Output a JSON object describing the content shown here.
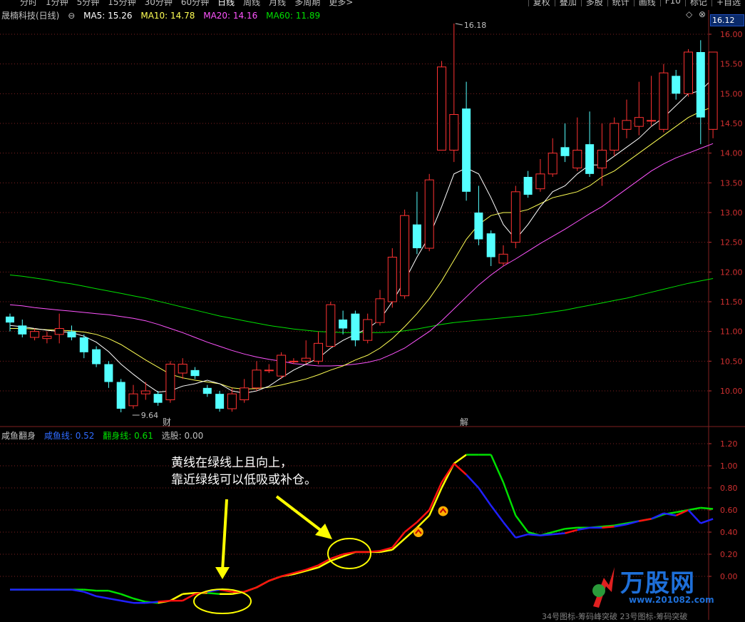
{
  "toolbar": {
    "periods": [
      "分时",
      "1分钟",
      "5分钟",
      "15分钟",
      "30分钟",
      "60分钟",
      "日线",
      "周线",
      "月线",
      "多周期",
      "更多>"
    ],
    "active_period": "日线",
    "tools": [
      "复权",
      "叠加",
      "多股",
      "统计",
      "画线",
      "F10",
      "标记",
      "+自选"
    ]
  },
  "main_legend": {
    "stock": "晟楠科技(日线)",
    "ma5": "MA5: 15.26",
    "ma10": "MA10: 14.78",
    "ma20": "MA20: 14.16",
    "ma60": "MA60: 11.89"
  },
  "colors": {
    "up": "#ff3232",
    "down": "#54ffff",
    "ma5": "#ffffff",
    "ma10": "#ffff54",
    "ma20": "#ff54ff",
    "ma60": "#00e000",
    "indicator_yellow": "#ffff00",
    "indicator_red": "#ff1010",
    "indicator_green": "#00e000",
    "indicator_blue": "#2020ff"
  },
  "current_price_tag": "16.12",
  "indicator_legend": {
    "name": "咸鱼翻身",
    "line1": "咸鱼线: 0.52",
    "line2": "翻身线: 0.61",
    "line3": "选股: 0.00"
  },
  "annotations": {
    "high": "16.18",
    "low": "9.64",
    "marker_cai": "财",
    "marker_jie": "解",
    "note_line1": "黄线在绿线上且向上，",
    "note_line2": "靠近绿线可以低吸或补仓。"
  },
  "watermark": {
    "brand": "万股网",
    "url": "www.201082.com"
  },
  "footer_text": "34号图标-筹码峰突破 23号图标-筹码突破",
  "chart_data": [
    {
      "type": "candlestick",
      "title": "晟楠科技(日线)",
      "ylim": [
        9.6,
        16.25
      ],
      "yticks": [
        10.0,
        10.5,
        11.0,
        11.5,
        12.0,
        12.5,
        13.0,
        13.5,
        14.0,
        14.5,
        15.0,
        15.5,
        16.0
      ],
      "candles": [
        {
          "o": 11.25,
          "c": 11.15,
          "h": 11.3,
          "l": 11.0
        },
        {
          "o": 11.1,
          "c": 10.95,
          "h": 11.2,
          "l": 10.9
        },
        {
          "o": 10.9,
          "c": 11.0,
          "h": 11.05,
          "l": 10.85
        },
        {
          "o": 10.88,
          "c": 10.92,
          "h": 11.0,
          "l": 10.8
        },
        {
          "o": 10.95,
          "c": 11.05,
          "h": 11.3,
          "l": 10.8
        },
        {
          "o": 11.0,
          "c": 10.9,
          "h": 11.1,
          "l": 10.85
        },
        {
          "o": 10.9,
          "c": 10.65,
          "h": 10.95,
          "l": 10.55
        },
        {
          "o": 10.7,
          "c": 10.45,
          "h": 10.75,
          "l": 10.4
        },
        {
          "o": 10.45,
          "c": 10.15,
          "h": 10.5,
          "l": 10.05
        },
        {
          "o": 10.15,
          "c": 9.7,
          "h": 10.2,
          "l": 9.64
        },
        {
          "o": 9.75,
          "c": 9.95,
          "h": 10.1,
          "l": 9.7
        },
        {
          "o": 9.95,
          "c": 10.0,
          "h": 10.15,
          "l": 9.85
        },
        {
          "o": 9.95,
          "c": 9.8,
          "h": 10.0,
          "l": 9.75
        },
        {
          "o": 9.85,
          "c": 10.45,
          "h": 10.5,
          "l": 9.8
        },
        {
          "o": 10.3,
          "c": 10.45,
          "h": 10.55,
          "l": 10.2
        },
        {
          "o": 10.35,
          "c": 10.25,
          "h": 10.4,
          "l": 10.2
        },
        {
          "o": 10.05,
          "c": 9.95,
          "h": 10.1,
          "l": 9.9
        },
        {
          "o": 9.95,
          "c": 9.7,
          "h": 10.0,
          "l": 9.65
        },
        {
          "o": 9.7,
          "c": 9.95,
          "h": 10.05,
          "l": 9.65
        },
        {
          "o": 9.85,
          "c": 10.05,
          "h": 10.2,
          "l": 9.8
        },
        {
          "o": 10.05,
          "c": 10.35,
          "h": 10.5,
          "l": 10.0
        },
        {
          "o": 10.35,
          "c": 10.35,
          "h": 10.45,
          "l": 10.3
        },
        {
          "o": 10.25,
          "c": 10.6,
          "h": 10.65,
          "l": 10.2
        },
        {
          "o": 10.5,
          "c": 10.5,
          "h": 10.55,
          "l": 10.45
        },
        {
          "o": 10.5,
          "c": 10.55,
          "h": 10.85,
          "l": 10.45
        },
        {
          "o": 10.5,
          "c": 10.8,
          "h": 11.0,
          "l": 10.45
        },
        {
          "o": 10.75,
          "c": 11.45,
          "h": 11.5,
          "l": 10.75
        },
        {
          "o": 11.2,
          "c": 11.05,
          "h": 11.35,
          "l": 10.95
        },
        {
          "o": 11.3,
          "c": 10.85,
          "h": 11.35,
          "l": 10.75
        },
        {
          "o": 10.85,
          "c": 11.2,
          "h": 11.3,
          "l": 10.8
        },
        {
          "o": 11.15,
          "c": 11.55,
          "h": 11.7,
          "l": 11.1
        },
        {
          "o": 11.5,
          "c": 12.25,
          "h": 12.4,
          "l": 11.4
        },
        {
          "o": 11.6,
          "c": 12.95,
          "h": 13.05,
          "l": 11.55
        },
        {
          "o": 12.8,
          "c": 12.4,
          "h": 13.35,
          "l": 12.3
        },
        {
          "o": 12.4,
          "c": 13.55,
          "h": 13.65,
          "l": 12.35
        },
        {
          "o": 14.05,
          "c": 15.45,
          "h": 15.55,
          "l": 14.05
        },
        {
          "o": 14.05,
          "c": 14.65,
          "h": 16.18,
          "l": 13.85
        },
        {
          "o": 14.75,
          "c": 13.35,
          "h": 15.2,
          "l": 13.2
        },
        {
          "o": 13.0,
          "c": 12.55,
          "h": 13.45,
          "l": 12.45
        },
        {
          "o": 12.65,
          "c": 12.25,
          "h": 12.7,
          "l": 12.1
        },
        {
          "o": 12.15,
          "c": 12.3,
          "h": 12.45,
          "l": 12.1
        },
        {
          "o": 12.5,
          "c": 13.35,
          "h": 13.45,
          "l": 12.4
        },
        {
          "o": 13.6,
          "c": 13.3,
          "h": 13.7,
          "l": 13.25
        },
        {
          "o": 13.4,
          "c": 13.65,
          "h": 13.9,
          "l": 13.35
        },
        {
          "o": 13.65,
          "c": 14.0,
          "h": 14.25,
          "l": 13.6
        },
        {
          "o": 14.1,
          "c": 13.95,
          "h": 14.5,
          "l": 13.85
        },
        {
          "o": 13.75,
          "c": 14.05,
          "h": 14.6,
          "l": 13.7
        },
        {
          "o": 14.15,
          "c": 13.65,
          "h": 14.7,
          "l": 13.6
        },
        {
          "o": 13.75,
          "c": 14.05,
          "h": 14.5,
          "l": 13.45
        },
        {
          "o": 14.05,
          "c": 14.5,
          "h": 14.6,
          "l": 13.95
        },
        {
          "o": 14.4,
          "c": 14.55,
          "h": 14.9,
          "l": 14.25
        },
        {
          "o": 14.45,
          "c": 14.6,
          "h": 15.2,
          "l": 14.3
        },
        {
          "o": 14.55,
          "c": 14.55,
          "h": 15.3,
          "l": 14.45
        },
        {
          "o": 14.4,
          "c": 15.35,
          "h": 15.5,
          "l": 14.35
        },
        {
          "o": 15.3,
          "c": 15.0,
          "h": 15.4,
          "l": 14.9
        },
        {
          "o": 15.0,
          "c": 15.7,
          "h": 15.75,
          "l": 14.95
        },
        {
          "o": 15.7,
          "c": 14.6,
          "h": 15.9,
          "l": 14.15
        },
        {
          "o": 14.4,
          "c": 15.7,
          "h": 15.7,
          "l": 14.25
        }
      ],
      "ma5": [
        11.1,
        11.08,
        11.05,
        11.02,
        11.0,
        10.98,
        10.92,
        10.82,
        10.66,
        10.45,
        10.28,
        10.12,
        9.98,
        10.0,
        10.08,
        10.12,
        10.18,
        10.12,
        10.0,
        9.96,
        10.0,
        10.08,
        10.22,
        10.35,
        10.45,
        10.55,
        10.72,
        10.85,
        10.95,
        11.05,
        11.2,
        11.5,
        11.85,
        12.25,
        12.6,
        13.1,
        13.65,
        13.75,
        13.65,
        13.25,
        12.8,
        12.55,
        12.8,
        13.1,
        13.35,
        13.45,
        13.65,
        13.8,
        13.8,
        13.95,
        14.1,
        14.25,
        14.45,
        14.6,
        14.8,
        15.0,
        15.05,
        15.26
      ],
      "ma10": [
        11.05,
        11.05,
        11.04,
        11.03,
        11.02,
        11.01,
        10.99,
        10.95,
        10.88,
        10.78,
        10.65,
        10.52,
        10.4,
        10.28,
        10.22,
        10.18,
        10.15,
        10.12,
        10.05,
        10.03,
        10.04,
        10.06,
        10.1,
        10.15,
        10.2,
        10.27,
        10.35,
        10.42,
        10.52,
        10.6,
        10.72,
        10.88,
        11.08,
        11.3,
        11.55,
        11.85,
        12.2,
        12.55,
        12.8,
        12.95,
        13.0,
        13.0,
        13.05,
        13.15,
        13.25,
        13.3,
        13.35,
        13.45,
        13.6,
        13.7,
        13.85,
        14.0,
        14.15,
        14.3,
        14.45,
        14.6,
        14.7,
        14.78
      ],
      "ma20": [
        11.45,
        11.43,
        11.4,
        11.38,
        11.36,
        11.34,
        11.32,
        11.3,
        11.28,
        11.25,
        11.22,
        11.18,
        11.12,
        11.05,
        10.98,
        10.9,
        10.82,
        10.75,
        10.68,
        10.62,
        10.57,
        10.53,
        10.5,
        10.46,
        10.44,
        10.42,
        10.42,
        10.43,
        10.45,
        10.48,
        10.53,
        10.62,
        10.72,
        10.86,
        11.0,
        11.18,
        11.38,
        11.58,
        11.78,
        11.95,
        12.1,
        12.22,
        12.35,
        12.48,
        12.6,
        12.72,
        12.85,
        12.98,
        13.1,
        13.25,
        13.4,
        13.55,
        13.7,
        13.82,
        13.92,
        14.0,
        14.08,
        14.16
      ],
      "ma60": [
        11.95,
        11.93,
        11.9,
        11.87,
        11.83,
        11.8,
        11.76,
        11.72,
        11.68,
        11.64,
        11.6,
        11.56,
        11.51,
        11.46,
        11.41,
        11.36,
        11.31,
        11.26,
        11.22,
        11.18,
        11.14,
        11.1,
        11.07,
        11.04,
        11.02,
        11.0,
        10.99,
        10.98,
        10.98,
        10.98,
        10.98,
        10.99,
        11.01,
        11.04,
        11.08,
        11.12,
        11.15,
        11.17,
        11.19,
        11.21,
        11.23,
        11.25,
        11.27,
        11.3,
        11.33,
        11.36,
        11.4,
        11.44,
        11.48,
        11.52,
        11.56,
        11.61,
        11.66,
        11.71,
        11.76,
        11.81,
        11.85,
        11.89
      ]
    },
    {
      "type": "line",
      "title": "咸鱼翻身",
      "ylim": [
        -0.2,
        1.25
      ],
      "yticks": [
        0.0,
        0.2,
        0.4,
        0.6,
        0.8,
        1.0,
        1.2
      ],
      "series": [
        {
          "name": "咸鱼线",
          "values": [
            -0.12,
            -0.12,
            -0.12,
            -0.12,
            -0.12,
            -0.12,
            -0.14,
            -0.18,
            -0.2,
            -0.22,
            -0.24,
            -0.24,
            -0.23,
            -0.22,
            -0.22,
            -0.16,
            -0.14,
            -0.12,
            -0.14,
            -0.14,
            -0.1,
            -0.04,
            0.0,
            0.03,
            0.06,
            0.1,
            0.16,
            0.2,
            0.22,
            0.22,
            0.23,
            0.26,
            0.4,
            0.49,
            0.6,
            0.85,
            1.02,
            0.92,
            0.8,
            0.64,
            0.49,
            0.35,
            0.38,
            0.37,
            0.38,
            0.39,
            0.42,
            0.44,
            0.44,
            0.45,
            0.47,
            0.5,
            0.52,
            0.57,
            0.55,
            0.6,
            0.48,
            0.52
          ]
        },
        {
          "name": "翻身线",
          "values": [
            -0.12,
            -0.12,
            -0.12,
            -0.12,
            -0.12,
            -0.12,
            -0.12,
            -0.13,
            -0.13,
            -0.16,
            -0.2,
            -0.23,
            -0.24,
            -0.22,
            -0.16,
            -0.15,
            -0.15,
            -0.16,
            -0.16,
            -0.14,
            -0.1,
            -0.04,
            0.0,
            0.02,
            0.05,
            0.08,
            0.14,
            0.18,
            0.22,
            0.22,
            0.22,
            0.24,
            0.34,
            0.44,
            0.55,
            0.8,
            1.02,
            1.1,
            1.1,
            1.1,
            0.85,
            0.55,
            0.4,
            0.37,
            0.4,
            0.43,
            0.44,
            0.44,
            0.45,
            0.46,
            0.48,
            0.5,
            0.52,
            0.56,
            0.58,
            0.6,
            0.62,
            0.61
          ]
        }
      ]
    }
  ]
}
